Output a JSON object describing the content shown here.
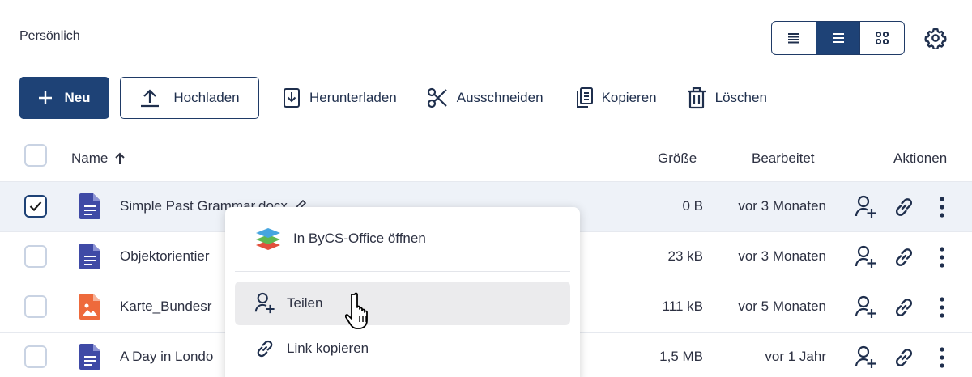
{
  "breadcrumb": "Persönlich",
  "view_toggle": {
    "options": [
      "compact-list-icon",
      "list-icon",
      "grid-icon"
    ],
    "active": 1
  },
  "toolbar": {
    "new_label": "Neu",
    "upload_label": "Hochladen",
    "download_label": "Herunterladen",
    "cut_label": "Ausschneiden",
    "copy_label": "Kopieren",
    "delete_label": "Löschen"
  },
  "table": {
    "headers": {
      "name": "Name",
      "size": "Größe",
      "modified": "Bearbeitet",
      "actions": "Aktionen"
    },
    "rows": [
      {
        "name": "Simple Past Grammar.docx",
        "size": "0 B",
        "modified": "vor 3 Monaten",
        "icon": "document-icon",
        "selected": true
      },
      {
        "name": "Objektorientier",
        "size": "23 kB",
        "modified": "vor 3 Monaten",
        "icon": "document-icon",
        "selected": false
      },
      {
        "name": "Karte_Bundesr",
        "size": "111 kB",
        "modified": "vor 5 Monaten",
        "icon": "image-icon",
        "selected": false
      },
      {
        "name": "A Day in Londo",
        "size": "1,5 MB",
        "modified": "vor 1 Jahr",
        "icon": "document-icon",
        "selected": false
      }
    ]
  },
  "context_menu": {
    "open_office": "In ByCS-Office öffnen",
    "share": "Teilen",
    "copy_link": "Link kopieren"
  },
  "colors": {
    "primary": "#1e4276",
    "doc_icon": "#3f4aa6",
    "image_icon": "#ee6a3c"
  }
}
